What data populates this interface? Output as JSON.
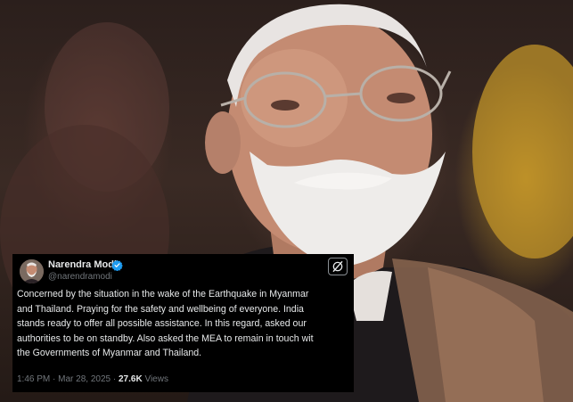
{
  "tweet": {
    "author_name": "Narendra Modi",
    "author_handle": "@narendramodi",
    "verified": true,
    "text_lines": [
      "Concerned by the situation in the wake of the Earthquake in Myanmar",
      "and Thailand. Praying for the safety and wellbeing of everyone. India",
      "stands ready to offer all possible assistance. In this regard, asked our",
      "authorities to be on standby. Also asked the MEA to remain in touch wit",
      "the Governments of Myanmar and Thailand."
    ],
    "time": "1:46 PM",
    "separator": "·",
    "date": "Mar 28, 2025",
    "views_count": "27.6K",
    "views_label": "Views",
    "platform_icon": "x-logo-icon",
    "verified_color": "#1d9bf0"
  }
}
